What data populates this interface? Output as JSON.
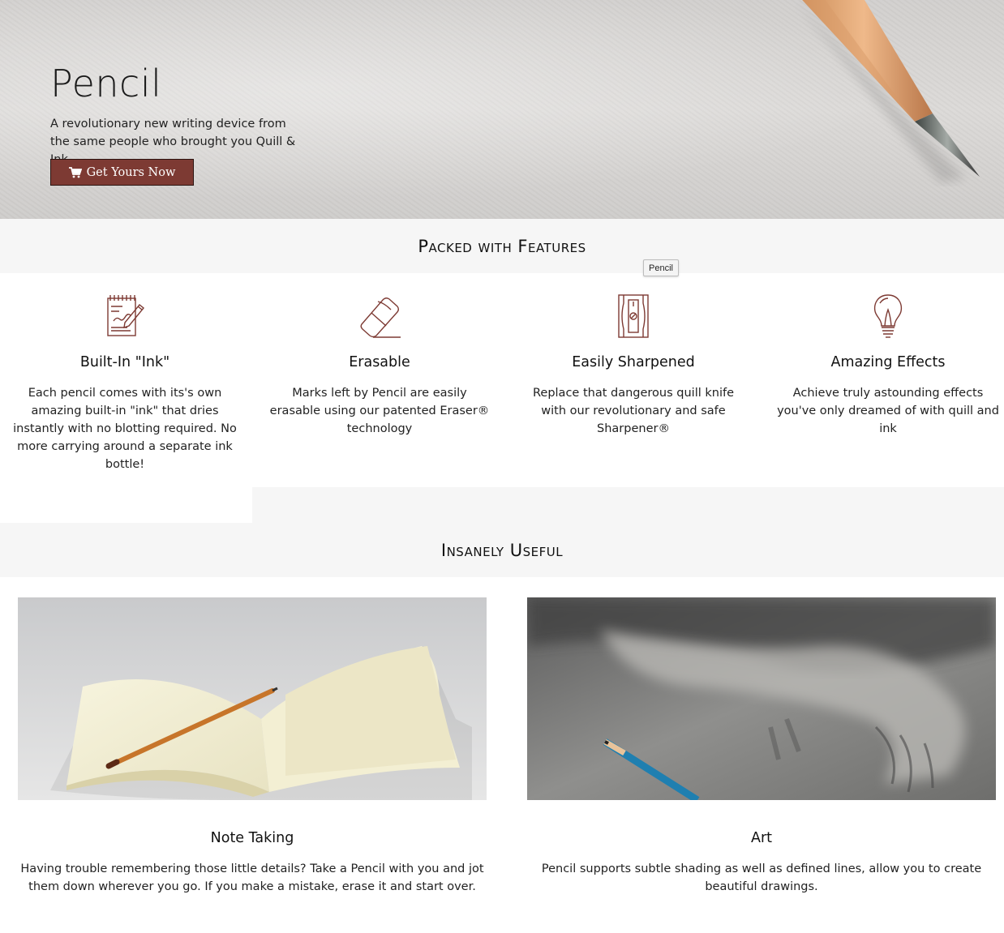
{
  "hero": {
    "title": "Pencil",
    "subtitle": "A revolutionary new writing device from the same people who brought you Quill & Ink",
    "cta_label": "Get Yours Now",
    "cta_icon": "shopping-cart-icon",
    "brand_color": "#7d3a33"
  },
  "features_section": {
    "heading": "Packed with Features",
    "tooltip": "Pencil",
    "items": [
      {
        "icon": "notepad-pencil-icon",
        "title": "Built-In \"Ink\"",
        "text": "Each pencil comes with its's own amazing built-in \"ink\" that dries instantly with no blotting required. No more carrying around a separate ink bottle!"
      },
      {
        "icon": "eraser-icon",
        "title": "Erasable",
        "text": "Marks left by Pencil are easily erasable using our patented Eraser® technology"
      },
      {
        "icon": "sharpener-icon",
        "title": "Easily Sharpened",
        "text": "Replace that dangerous quill knife with our revolutionary and safe Sharpener®"
      },
      {
        "icon": "lightbulb-icon",
        "title": "Amazing Effects",
        "text": "Achieve truly astounding effects you've only dreamed of with quill and ink"
      }
    ]
  },
  "useful_section": {
    "heading": "Insanely Useful",
    "items": [
      {
        "image": "notebook-pencil-photo",
        "title": "Note Taking",
        "text": "Having trouble remembering those little details? Take a Pencil with you and jot them down wherever you go. If you make a mistake, erase it and start over."
      },
      {
        "image": "art-drawing-photo",
        "title": "Art",
        "text": "Pencil supports subtle shading as well as defined lines, allow you to create beautiful drawings."
      }
    ]
  }
}
